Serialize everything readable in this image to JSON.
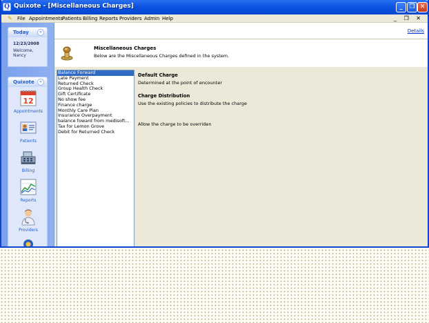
{
  "window": {
    "title": "Quixote - [Miscellaneous Charges]",
    "icon_letter": "Q",
    "min_glyph": "_",
    "max_glyph": "❐",
    "close_glyph": "✕"
  },
  "menu": {
    "items": [
      "File",
      "Appointments",
      "Patients",
      "Billing",
      "Reports",
      "Providers",
      "Admin",
      "Help"
    ],
    "mdi_controls": "_ ❐ ✕"
  },
  "nav": {
    "today": {
      "title": "Today",
      "date": "12/23/2008",
      "welcome": "Welcome,",
      "user": "Nancy"
    },
    "quixote": {
      "title": "Quixote",
      "items": [
        {
          "label": "Appointments",
          "icon": "calendar-icon",
          "calendar_day": "12"
        },
        {
          "label": "Patients",
          "icon": "patient-card-icon"
        },
        {
          "label": "Billing",
          "icon": "cash-register-icon"
        },
        {
          "label": "Reports",
          "icon": "chart-icon"
        },
        {
          "label": "Providers",
          "icon": "doctor-icon"
        }
      ]
    },
    "collapse_glyph": "«"
  },
  "content": {
    "details_link": "Details",
    "header": {
      "title": "Miscellaneous Charges",
      "subtitle": "Below are the Miscellaneous Charges defined in the system.",
      "icon": "stamp-icon"
    },
    "charges": [
      "Balance Forward",
      "Late Payment",
      "Returned Check",
      "Group Health Check",
      "Gift Certificate",
      "No show fee",
      "Finance charge",
      "Monthly Care Plan",
      "Insurance Overpayment",
      "balance foward from medisoft...",
      "Tax for Lemon Grove",
      "Debit for Returned Check"
    ],
    "selected_index": 0,
    "detail": {
      "default_charge_label": "Default Charge",
      "default_charge_value": "Determined at the point of encounter",
      "distribution_label": "Charge Distribution",
      "distribution_value": "Use the existing policies to distribute the charge",
      "override_text": "Allow the charge to be overriden"
    }
  },
  "colors": {
    "titlebar": "#0a54e0",
    "nav_background": "#7aa0ec",
    "selection": "#316ac5",
    "link": "#0033cc"
  }
}
